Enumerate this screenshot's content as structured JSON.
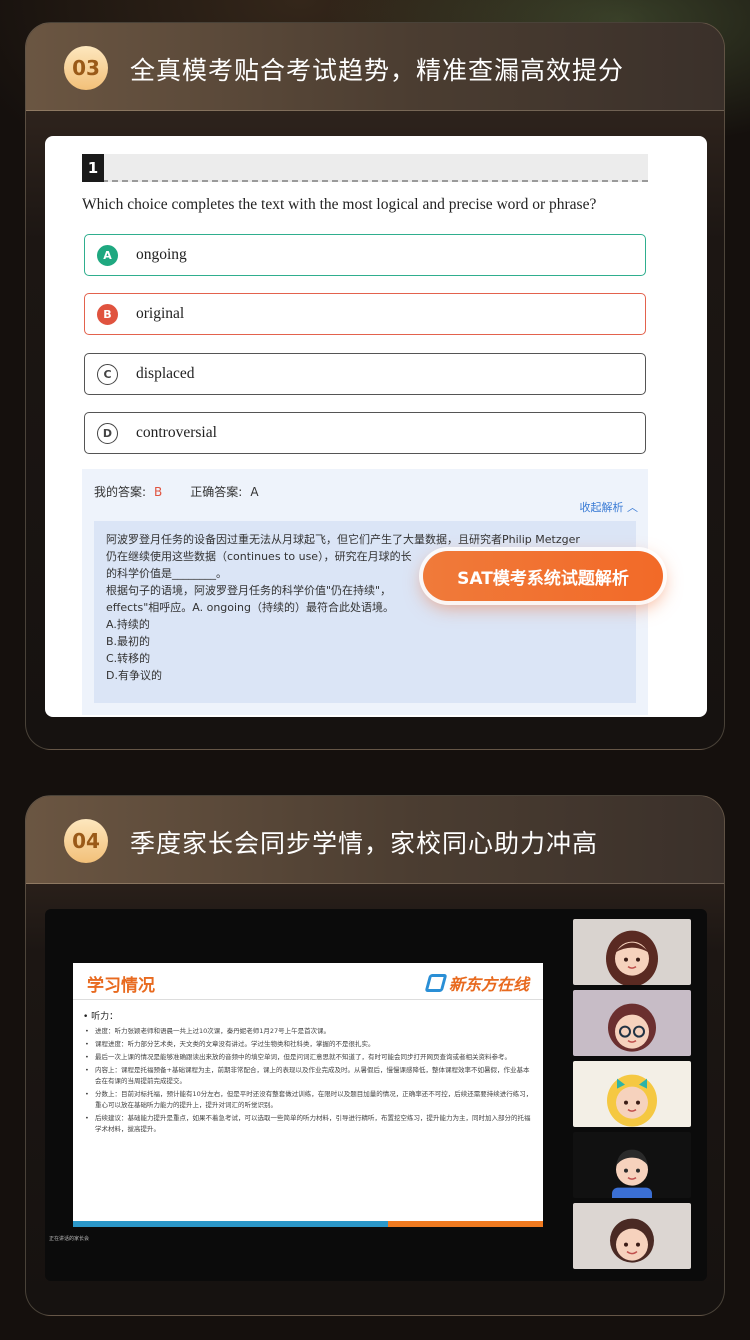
{
  "section3": {
    "number": "03",
    "title": "全真模考贴合考试趋势，精准查漏高效提分",
    "question": {
      "number": "1",
      "prompt": "Which choice completes the text with the most logical and precise word or phrase?",
      "options": [
        {
          "letter": "A",
          "text": "ongoing",
          "state": "correct"
        },
        {
          "letter": "B",
          "text": "original",
          "state": "wrong"
        },
        {
          "letter": "C",
          "text": "displaced",
          "state": "neutral"
        },
        {
          "letter": "D",
          "text": "controversial",
          "state": "neutral"
        }
      ]
    },
    "my_answer_label": "我的答案:",
    "my_answer_value": "B",
    "correct_answer_label": "正确答案:",
    "correct_answer_value": "A",
    "collapse_link": "收起解析 ︿",
    "explanation_lines": [
      "阿波罗登月任务的设备因过重无法从月球起飞，但它们产生了大量数据，且研究者Philip Metzger",
      "仍在继续使用这些数据（continues to use），研究在月球的长",
      "的科学价值是________。",
      "根据句子的语境，阿波罗登月任务的科学价值\"仍在持续\"，",
      "effects\"相呼应。A. ongoing（持续的）最符合此处语境。",
      "A.持续的",
      "B.最初的",
      "C.转移的",
      "D.有争议的"
    ],
    "badge": "SAT模考系统试题解析"
  },
  "section4": {
    "number": "04",
    "title": "季度家长会同步学情，家校同心助力冲高",
    "slide": {
      "title": "学习情况",
      "logo": "新东方在线",
      "heading": "• 听力：",
      "bullets": [
        "进度：听力张颖老师和语晨一共上过10次课，秦丹妮老师1月27号上午是首次课。",
        "课程进度：听力部分艺术类，天文类的文章没有讲过。学过生物类和社科类，掌握的不是很扎实。",
        "最后一次上课的情况是能够准确跟读出来放的音频中的填空单词，但是问词汇意思就不知道了，有时可能会同步打开网页查询或者相关资料参考。",
        "内容上：课程是托福预备+基础课程为主，前期非常配合，课上的表现以及作业完成及时。从暑假后，慢慢课感降低，整体课程效率不如暑假，作业基本会在有课的当周提前完成提交。",
        "分数上：目前对标托福，预计能有10分左右，但是平时还没有整套做过训练，在限时以及题目加量的情况，正确率还不可控，后续还需要持续进行练习，重心可以放在基础听力能力的提升上，提升对词汇的听觉识别。",
        "后续建议：基础能力提升是重点，如果不着急考试，可以选取一些简单的听力材料，引导进行精听，布置挖空练习，提升能力为主，同时加入部分的托福学术材料，拔高提升。"
      ],
      "caption": "正在讲话的家长会"
    }
  }
}
